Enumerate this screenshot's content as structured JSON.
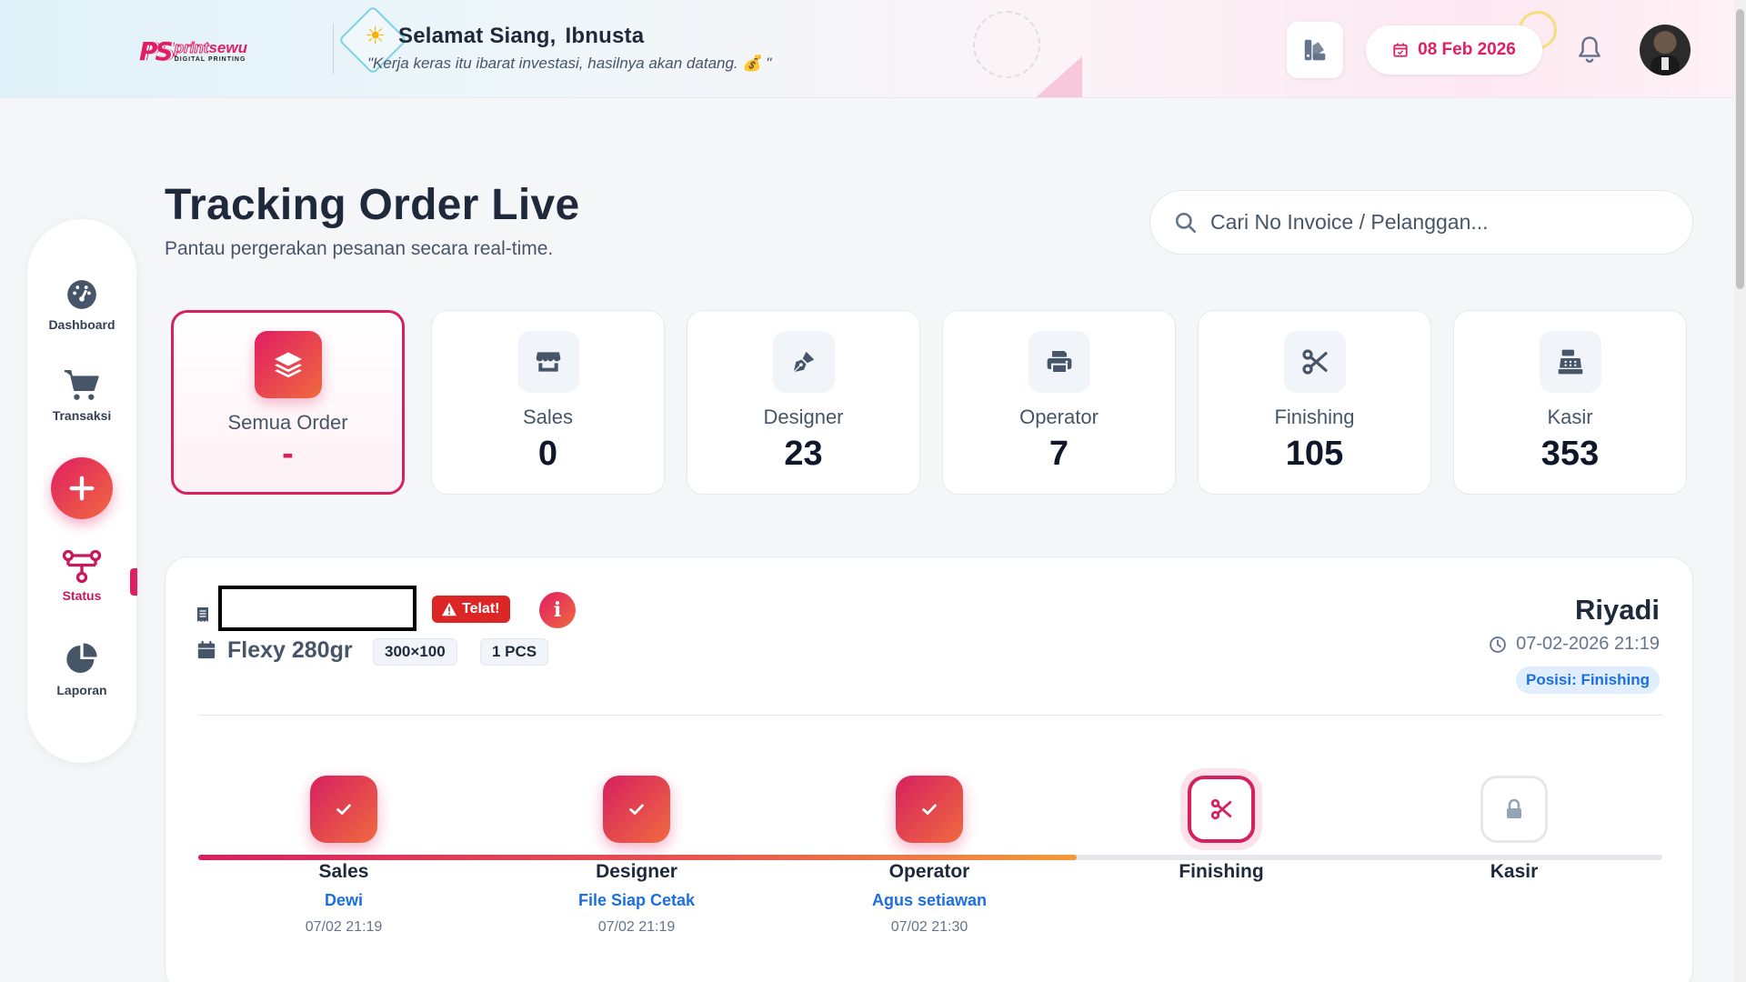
{
  "header": {
    "logo": {
      "mark": "PS",
      "brand_print": "print",
      "brand_sewu": "sewu",
      "sub": "DIGITAL PRINTING"
    },
    "greeting": "Selamat Siang,",
    "user_name": "Ibnusta",
    "quote": "\"Kerja keras itu ibarat investasi, hasilnya akan datang. 💰 \"",
    "date": "08 Feb 2026",
    "icons": {
      "sun": "sun-icon",
      "theme": "palette-icon",
      "calendar": "calendar-icon",
      "bell": "bell-icon"
    }
  },
  "sidebar": {
    "items": [
      {
        "label": "Dashboard",
        "icon": "gauge-icon"
      },
      {
        "label": "Transaksi",
        "icon": "cart-icon"
      },
      {
        "label": "Status",
        "icon": "workflow-icon",
        "active": true
      },
      {
        "label": "Laporan",
        "icon": "pie-chart-icon"
      }
    ],
    "add_icon": "plus-icon"
  },
  "page": {
    "title": "Tracking Order Live",
    "subtitle": "Pantau pergerakan pesanan secara real-time.",
    "search_placeholder": "Cari No Invoice / Pelanggan..."
  },
  "stats": [
    {
      "label": "Semua Order",
      "value": "-",
      "icon": "layers-icon",
      "active": true
    },
    {
      "label": "Sales",
      "value": "0",
      "icon": "store-icon"
    },
    {
      "label": "Designer",
      "value": "23",
      "icon": "pen-icon"
    },
    {
      "label": "Operator",
      "value": "7",
      "icon": "printer-icon"
    },
    {
      "label": "Finishing",
      "value": "105",
      "icon": "scissors-icon"
    },
    {
      "label": "Kasir",
      "value": "353",
      "icon": "cash-register-icon"
    }
  ],
  "order": {
    "late_badge": "Telat!",
    "info_label": "i",
    "product": "Flexy 280gr",
    "size_tag": "300×100",
    "qty_tag": "1 PCS",
    "customer": "Riyadi",
    "datetime": "07-02-2026 21:19",
    "position": "Posisi: Finishing",
    "progress_fraction": 0.6,
    "steps": [
      {
        "name": "Sales",
        "person": "Dewi",
        "time": "07/02 21:19",
        "state": "done"
      },
      {
        "name": "Designer",
        "person": "File Siap Cetak",
        "time": "07/02 21:19",
        "state": "done"
      },
      {
        "name": "Operator",
        "person": "Agus setiawan",
        "time": "07/02 21:30",
        "state": "done"
      },
      {
        "name": "Finishing",
        "person": "",
        "time": "",
        "state": "current"
      },
      {
        "name": "Kasir",
        "person": "",
        "time": "",
        "state": "locked"
      }
    ]
  },
  "colors": {
    "accent": "#e11d63",
    "accent_end": "#f06a3f",
    "link": "#1d6fe0",
    "late": "#dc2626"
  }
}
